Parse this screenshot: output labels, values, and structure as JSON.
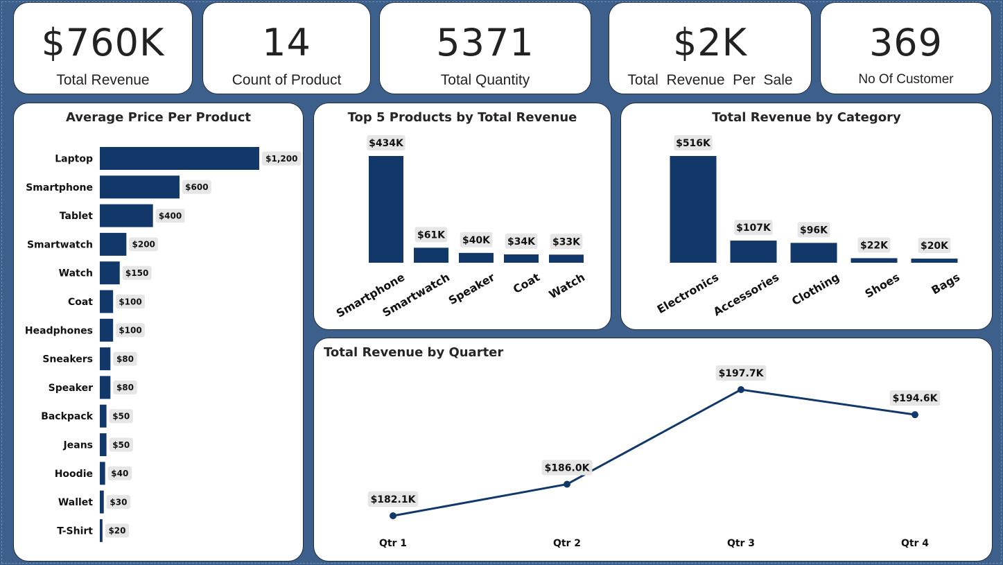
{
  "kpis": [
    {
      "value": "$760K",
      "label": "Total Revenue"
    },
    {
      "value": "14",
      "label": "Count of Product"
    },
    {
      "value": "5371",
      "label": "Total Quantity"
    },
    {
      "value": "$2K",
      "label": "Total  Revenue  Per  Sale"
    },
    {
      "value": "369",
      "label": "No Of Customer"
    }
  ],
  "colors": {
    "bar": "#12386a",
    "label_bg": "#e6e6e6",
    "background": "#3d5f8c"
  },
  "chart_data": [
    {
      "type": "bar",
      "orientation": "horizontal",
      "title": "Average Price Per Product",
      "categories": [
        "Laptop",
        "Smartphone",
        "Tablet",
        "Smartwatch",
        "Watch",
        "Coat",
        "Headphones",
        "Sneakers",
        "Speaker",
        "Backpack",
        "Jeans",
        "Hoodie",
        "Wallet",
        "T-Shirt"
      ],
      "values": [
        1200,
        600,
        400,
        200,
        150,
        100,
        100,
        80,
        80,
        50,
        50,
        40,
        30,
        20
      ],
      "data_labels": [
        "$1,200",
        "$600",
        "$400",
        "$200",
        "$150",
        "$100",
        "$100",
        "$80",
        "$80",
        "$50",
        "$50",
        "$40",
        "$30",
        "$20"
      ]
    },
    {
      "type": "bar",
      "title": "Top 5 Products by Total Revenue",
      "categories": [
        "Smartphone",
        "Smartwatch",
        "Speaker",
        "Coat",
        "Watch"
      ],
      "values": [
        434,
        61,
        40,
        34,
        33
      ],
      "data_labels": [
        "$434K",
        "$61K",
        "$40K",
        "$34K",
        "$33K"
      ]
    },
    {
      "type": "bar",
      "title": "Total Revenue by Category",
      "categories": [
        "Electronics",
        "Accessories",
        "Clothing",
        "Shoes",
        "Bags"
      ],
      "values": [
        516,
        107,
        96,
        22,
        20
      ],
      "data_labels": [
        "$516K",
        "$107K",
        "$96K",
        "$22K",
        "$20K"
      ]
    },
    {
      "type": "line",
      "title": "Total Revenue by Quarter",
      "categories": [
        "Qtr 1",
        "Qtr 2",
        "Qtr 3",
        "Qtr 4"
      ],
      "values": [
        182.1,
        186.0,
        197.7,
        194.6
      ],
      "data_labels": [
        "$182.1K",
        "$186.0K",
        "$197.7K",
        "$194.6K"
      ]
    }
  ]
}
